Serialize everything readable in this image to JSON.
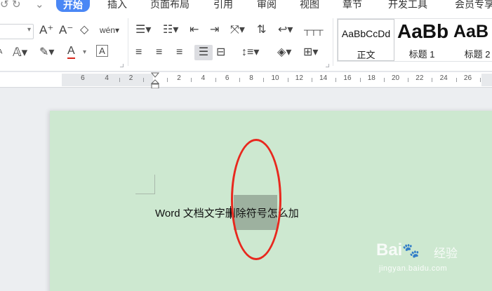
{
  "quick_access": {
    "undo_icon": "↺",
    "redo_icon": "↻",
    "more_icon": "⌄"
  },
  "tabs": [
    {
      "label": "开始",
      "active": true
    },
    {
      "label": "插入"
    },
    {
      "label": "页面布局"
    },
    {
      "label": "引用"
    },
    {
      "label": "审阅"
    },
    {
      "label": "视图"
    },
    {
      "label": "章节"
    },
    {
      "label": "开发工具"
    },
    {
      "label": "会员专享"
    }
  ],
  "ribbon": {
    "font": {
      "grow": "A⁺",
      "shrink": "A⁻",
      "clear_format": "◇",
      "pinyin": "wén",
      "font_color": "A",
      "char_border": "A"
    },
    "style_gallery": [
      {
        "sample": "AaBbCcDd",
        "name": "正文"
      },
      {
        "sample": "AaBb",
        "name": "标题 1"
      },
      {
        "sample": "AaB",
        "name": "标题 2"
      }
    ]
  },
  "ruler": {
    "left_labels": [
      "6",
      "4",
      "2"
    ],
    "right_labels": [
      "2",
      "4",
      "6",
      "8",
      "10",
      "12",
      "14",
      "16",
      "18",
      "20",
      "22",
      "24",
      "26"
    ]
  },
  "document": {
    "text": "Word 文档文字删除符号怎么加"
  },
  "watermark": {
    "logo": "Bai",
    "logo_cn": "经验",
    "url": "jingyan.baidu.com"
  },
  "colors": {
    "active_tab": "#4a87f5",
    "page_background": "#cde8d0",
    "annotation": "#e8281e",
    "highlight": "#9db19f"
  }
}
